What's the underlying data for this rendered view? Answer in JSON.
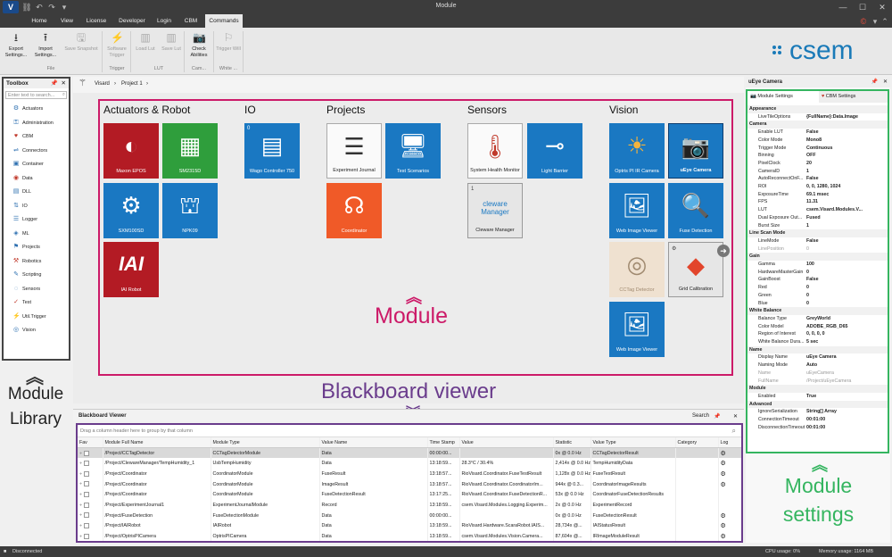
{
  "window": {
    "title": "Module",
    "logo": "V"
  },
  "menu": {
    "tabs": [
      "Home",
      "View",
      "License",
      "Developer",
      "Login",
      "CBM",
      "Commands"
    ],
    "active": "Commands"
  },
  "ribbon": {
    "buttons": [
      {
        "label": "Export Settings...",
        "icon": "download-icon",
        "enabled": true
      },
      {
        "label": "Import Settings...",
        "icon": "upload-icon",
        "enabled": true
      },
      {
        "label": "Save Snapshot",
        "icon": "save-icon",
        "enabled": false
      },
      {
        "label": "Software Trigger",
        "icon": "lightning-icon",
        "enabled": false
      },
      {
        "label": "Load Lut",
        "icon": "chart-icon",
        "enabled": false
      },
      {
        "label": "Save Lut",
        "icon": "chart-save-icon",
        "enabled": false
      },
      {
        "label": "Check Abilities",
        "icon": "camera-icon",
        "enabled": true
      },
      {
        "label": "Trigger Will",
        "icon": "trigger-icon",
        "enabled": false
      }
    ],
    "groups": [
      "File",
      "Trigger",
      "LUT",
      "Cam...",
      "White ..."
    ],
    "brand": "csem"
  },
  "toolbox": {
    "title": "Toolbox",
    "search_placeholder": "Enter text to search...",
    "items": [
      {
        "label": "Actuators",
        "icon": "actuator-icon"
      },
      {
        "label": "Administration",
        "icon": "admin-icon"
      },
      {
        "label": "CBM",
        "icon": "heart-icon"
      },
      {
        "label": "Connectors",
        "icon": "connector-icon"
      },
      {
        "label": "Container",
        "icon": "container-icon"
      },
      {
        "label": "Data",
        "icon": "data-icon"
      },
      {
        "label": "DLL",
        "icon": "dll-icon"
      },
      {
        "label": "IO",
        "icon": "io-icon"
      },
      {
        "label": "Logger",
        "icon": "logger-icon"
      },
      {
        "label": "ML",
        "icon": "ml-icon"
      },
      {
        "label": "Projects",
        "icon": "projects-icon"
      },
      {
        "label": "Robotics",
        "icon": "robot-icon"
      },
      {
        "label": "Scripting",
        "icon": "script-icon"
      },
      {
        "label": "Sensors",
        "icon": "sensor-icon"
      },
      {
        "label": "Test",
        "icon": "test-icon"
      },
      {
        "label": "Util.Trigger",
        "icon": "lightning-icon"
      },
      {
        "label": "Vision",
        "icon": "vision-icon"
      }
    ]
  },
  "annotations": {
    "module_library": "Module Library",
    "module": "Module",
    "blackboard": "Blackboard viewer",
    "module_settings": "Module settings"
  },
  "breadcrumb": {
    "root": "Visard",
    "child": "Project 1"
  },
  "categories": {
    "actuators": "Actuators & Robot",
    "io": "IO",
    "projects": "Projects",
    "sensors": "Sensors",
    "vision": "Vision"
  },
  "tiles": {
    "maxon": "Maxon EPOS",
    "sm2315": "SM2315D",
    "sxm": "SXM100SD",
    "npk": "NPK09",
    "iai": "IAI Robot",
    "iai_logo": "IAI",
    "wago": "Wago Controller 750",
    "wago_badge": "0",
    "journal": "Experiment Journal",
    "scenarios": "Test Scenarios",
    "coordinator": "Coordinator",
    "health": "System Health Monitor",
    "barrier": "Light Barrier",
    "cleware": "Cleware Manager",
    "cleware_badge": "1",
    "cleware_logo": "cleware Manager",
    "optris": "Optris PI IR Camera",
    "ueye": "uEye Camera",
    "webimg1": "Web Image Viewer",
    "fuse": "Fuse Detection",
    "cctag": "CCTag Detector",
    "grid": "Grid Calibration",
    "webimg2": "Web Image Viewer"
  },
  "blackboard": {
    "title": "Blackboard Viewer",
    "search": "Search",
    "drag_hint": "Drag a column header here to group by that column",
    "columns": [
      "Fav",
      "Module Full Name",
      "Module Type",
      "Value Name",
      "Time Stamp",
      "Value",
      "Statistic",
      "Value Type",
      "Category",
      "Log"
    ],
    "rows": [
      [
        "/Project/CCTagDetector",
        "CCTagDetectorModule",
        "Data",
        "00:00:00...",
        "",
        "0x @ 0.0 Hz",
        "CCTagDetectorResult"
      ],
      [
        "/Project/ClewareManager/TempHumidity_1",
        "UsbTempHumidity",
        "Data",
        "13:18:59...",
        "28.3°C / 30.4%",
        "2,414x @ 0.0 Hz",
        "TempHumidityData"
      ],
      [
        "/Project/Coordinator",
        "CoordinatorModule",
        "FuseResult",
        "13:18:57...",
        "RioVisard.Coordinator.FuseTestResult",
        "1,128x @ 0.0 Hz",
        "FuseTestResult"
      ],
      [
        "/Project/Coordinator",
        "CoordinatorModule",
        "ImageResult",
        "13:18:57...",
        "RioVisard.Coordinator.CoordinatorIm...",
        "944x @ 0.3...",
        "CoordinatorImageResults"
      ],
      [
        "/Project/Coordinator",
        "CoordinatorModule",
        "FuseDetectionResult",
        "13:17:25...",
        "RioVisard.Coordinator.FuseDetectionR...",
        "53x @ 0.0 Hz",
        "CoordinatorFuseDetectionResults"
      ],
      [
        "/Project/ExperimentJournal1",
        "ExperimentJournalModule",
        "Record",
        "13:18:59...",
        "csem.Visard.Modules.Logging.Experim...",
        "2x @ 0.0 Hz",
        "ExperimentRecord"
      ],
      [
        "/Project/FuseDetection",
        "FuseDetectionModule",
        "Data",
        "00:00:00...",
        "",
        "0x @ 0.0 Hz",
        "FuseDetectionResult"
      ],
      [
        "/Project/IAIRobot",
        "IAIRobot",
        "Data",
        "13:18:59...",
        "RioVisard.Hardware.ScaraRobot.IAIS...",
        "28,734x @...",
        "IAIStatusResult"
      ],
      [
        "/Project/OptrisPICamera",
        "OptrisPICamera",
        "Data",
        "13:18:59...",
        "csem.Visard.Modules.Vision.Camera...",
        "87,604x @...",
        "IRImageModuleResult"
      ]
    ]
  },
  "status": {
    "left": "Disconnected",
    "cpu": "CPU usage: 0%",
    "memory": "Memory usage: 1164 MB"
  },
  "settings": {
    "title": "uEye Camera",
    "tab1": "Module Settings",
    "tab2": "CBM Settings",
    "rows": [
      {
        "type": "cat",
        "k": "Appearance"
      },
      {
        "k": "LiveTileOptions",
        "v": "{FullName}:Data.Image"
      },
      {
        "type": "cat",
        "k": "Camera"
      },
      {
        "k": "Enable LUT",
        "v": "False"
      },
      {
        "k": "Color Mode",
        "v": "Mono8"
      },
      {
        "k": "Trigger Mode",
        "v": "Continuous"
      },
      {
        "k": "Binning",
        "v": "OFF"
      },
      {
        "k": "PixelClock",
        "v": "20"
      },
      {
        "k": "CameraID",
        "v": "1"
      },
      {
        "k": "AutoReconnectOnF...",
        "v": "False"
      },
      {
        "k": "ROI",
        "v": "0, 0, 1280, 1024"
      },
      {
        "k": "ExposureTime",
        "v": "69.1 msec"
      },
      {
        "k": "FPS",
        "v": "11.31"
      },
      {
        "k": "LUT",
        "v": "csem.Visard.Modules.V..."
      },
      {
        "k": "Dual Exposure Out...",
        "v": "Fused"
      },
      {
        "k": "Burst Size",
        "v": "1"
      },
      {
        "type": "cat",
        "k": "Line Scan Mode"
      },
      {
        "k": "LineMode",
        "v": "False"
      },
      {
        "k": "LinePosition",
        "v": "0",
        "dis": true
      },
      {
        "type": "cat",
        "k": "Gain"
      },
      {
        "k": "Gamma",
        "v": "100"
      },
      {
        "k": "HardwareMasterGain",
        "v": "0"
      },
      {
        "k": "GainBoost",
        "v": "False"
      },
      {
        "k": "Red",
        "v": "0"
      },
      {
        "k": "Green",
        "v": "0"
      },
      {
        "k": "Blue",
        "v": "0"
      },
      {
        "type": "cat",
        "k": "White Balance"
      },
      {
        "k": "Balance Type",
        "v": "GreyWorld"
      },
      {
        "k": "Color Model",
        "v": "ADOBE_RGB_D65"
      },
      {
        "k": "Region of Interest",
        "v": "0, 0, 0, 0"
      },
      {
        "k": "White Balance Dura...",
        "v": "5 sec"
      },
      {
        "type": "cat",
        "k": "Name"
      },
      {
        "k": "Display Name",
        "v": "uEye Camera"
      },
      {
        "k": "Naming Mode",
        "v": "Auto"
      },
      {
        "k": "Name",
        "v": "uEyeCamera",
        "dis": true
      },
      {
        "k": "FullName",
        "v": "/Project/uEyeCamera",
        "dis": true
      },
      {
        "type": "cat",
        "k": "Module"
      },
      {
        "k": "Enabled",
        "v": "True"
      },
      {
        "type": "cat",
        "k": "Advanced"
      },
      {
        "k": "IgnoreSerialization",
        "v": "String[] Array"
      },
      {
        "k": "ConnectionTimeout",
        "v": "00:01:00"
      },
      {
        "k": "DisconnectionTimeout",
        "v": "00:01:00"
      }
    ]
  },
  "colors": {
    "module_box": "#cc1a68",
    "blackboard_box": "#6a3c8c",
    "settings_box": "#35b560",
    "tile_blue": "#1a78c2",
    "tile_red": "#b31b24",
    "tile_green": "#2f9e3c",
    "tile_orange": "#f05a28"
  }
}
